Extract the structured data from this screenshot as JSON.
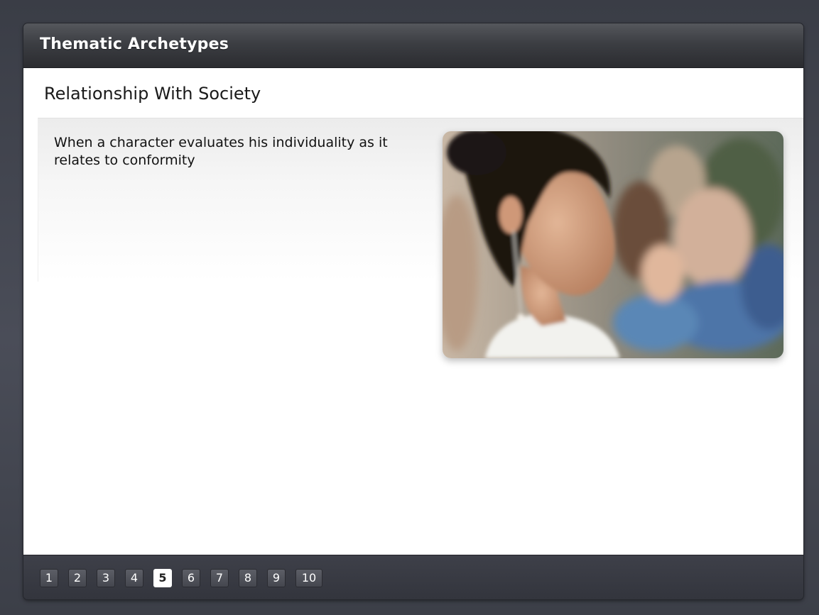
{
  "header": {
    "title": "Thematic Archetypes"
  },
  "slide": {
    "title": "Relationship With Society",
    "text": "When a character evaluates his individuality as it relates to conformity",
    "image_alt": "young woman in profile in front of a blurred crowd"
  },
  "navigation": {
    "current_page": "5",
    "pages": [
      "1",
      "2",
      "3",
      "4",
      "5",
      "6",
      "7",
      "8",
      "9",
      "10"
    ]
  },
  "colors": {
    "title_bar": "#3c3e43",
    "nav_bar": "#3a3c44",
    "content_bg": "#ffffff",
    "active_page_bg": "#ffffff"
  }
}
